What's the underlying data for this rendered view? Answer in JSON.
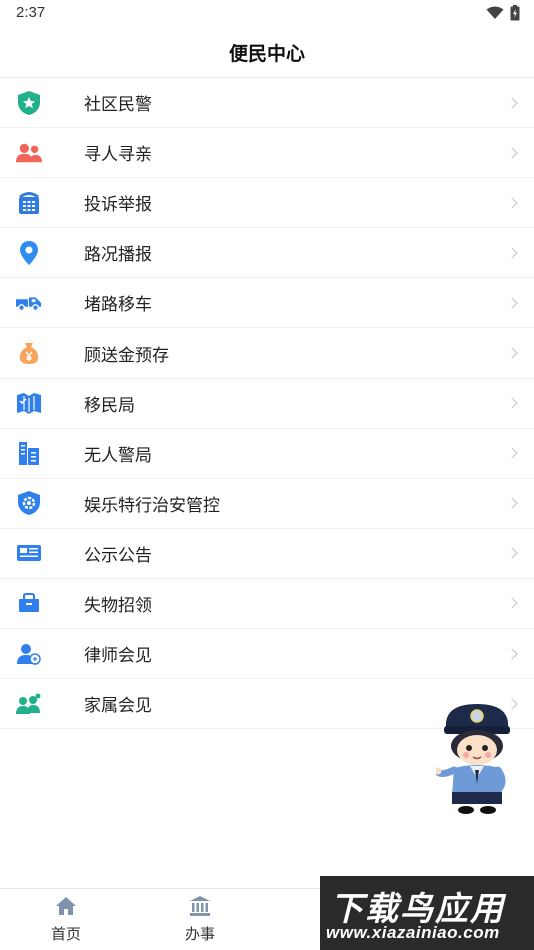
{
  "status_bar": {
    "time": "2:37",
    "icons": [
      "wifi-icon",
      "battery-charging-icon"
    ]
  },
  "header": {
    "title": "便民中心"
  },
  "menu": [
    {
      "label": "社区民警",
      "icon": "shield-star-icon",
      "color": "#20b08a"
    },
    {
      "label": "寻人寻亲",
      "icon": "people-icon",
      "color": "#f2665a"
    },
    {
      "label": "投诉举报",
      "icon": "phone-icon",
      "color": "#2f7ce0"
    },
    {
      "label": "路况播报",
      "icon": "location-pin-icon",
      "color": "#2f8cf0"
    },
    {
      "label": "堵路移车",
      "icon": "tow-truck-icon",
      "color": "#2f80ed"
    },
    {
      "label": "顾送金预存",
      "icon": "money-bag-icon",
      "color": "#f5a45a"
    },
    {
      "label": "移民局",
      "icon": "map-book-icon",
      "color": "#2f80ed"
    },
    {
      "label": "无人警局",
      "icon": "building-icon",
      "color": "#2f80ed"
    },
    {
      "label": "娱乐特行治安管控",
      "icon": "shield-gear-icon",
      "color": "#2f80ed"
    },
    {
      "label": "公示公告",
      "icon": "notice-board-icon",
      "color": "#2f80ed"
    },
    {
      "label": "失物招领",
      "icon": "lost-box-icon",
      "color": "#2f80ed"
    },
    {
      "label": "律师会见",
      "icon": "lawyer-icon",
      "color": "#2f80ed"
    },
    {
      "label": "家属会见",
      "icon": "family-icon",
      "color": "#20b08a"
    }
  ],
  "tab_bar": [
    {
      "label": "首页",
      "icon": "home-icon"
    },
    {
      "label": "办事",
      "icon": "government-building-icon"
    }
  ],
  "watermark": {
    "title": "下载鸟应用",
    "url": "www.xiazainiao.com"
  }
}
